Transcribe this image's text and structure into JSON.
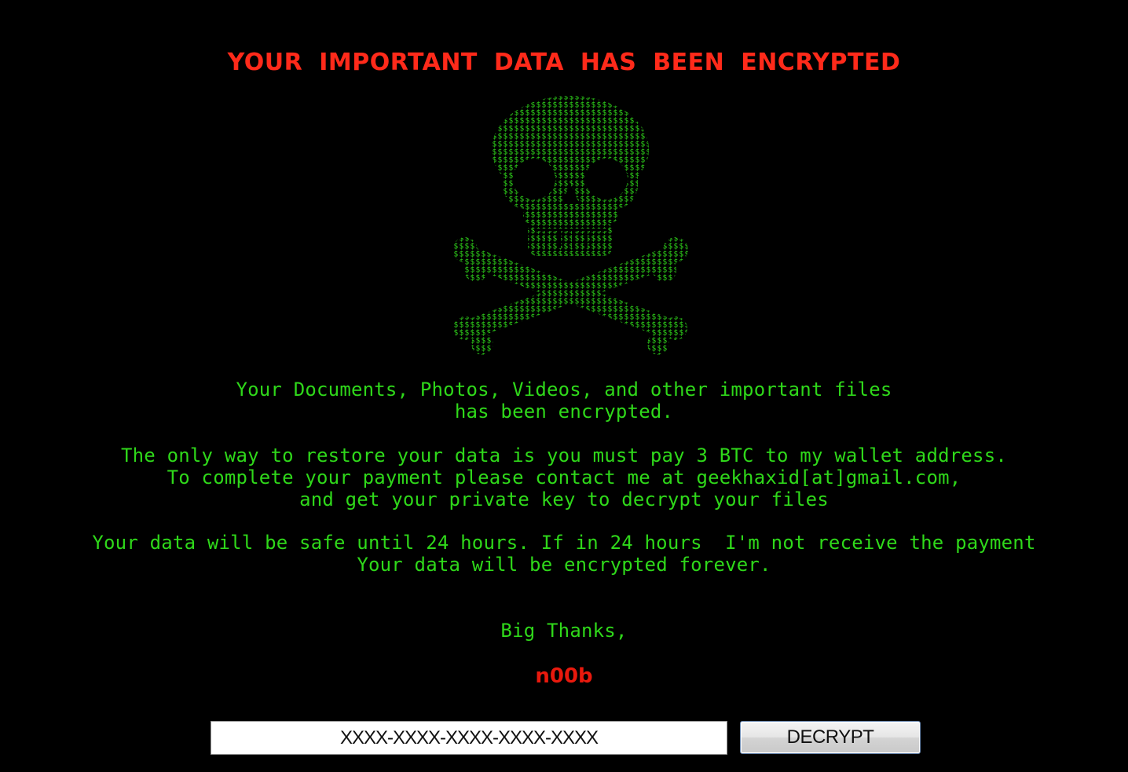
{
  "header": {
    "title": "YOUR IMPORTANT DATA HAS BEEN ENCRYPTED"
  },
  "skull": {
    "icon": "skull-crossbones-icon",
    "glyph": "$",
    "color": "#2fd81a"
  },
  "message": {
    "paragraph1": "Your Documents, Photos, Videos, and other important files\nhas been encrypted.",
    "paragraph2": "The only way to restore your data is you must pay 3 BTC to my wallet address.\nTo complete your payment please contact me at geekhaxid[at]gmail.com,\nand get your private key to decrypt your files",
    "paragraph3": "Your data will be safe until 24 hours. If in 24 hours  I'm not receive the payment\nYour data will be encrypted forever.",
    "closing": "Big Thanks,"
  },
  "signature": "n00b",
  "key_form": {
    "placeholder": "XXXX-XXXX-XXXX-XXXX-XXXX",
    "value": "",
    "button_label": "DECRYPT"
  },
  "colors": {
    "background": "#000000",
    "title": "#ff2a1a",
    "text": "#2fd81a",
    "signature": "#e8190d"
  }
}
